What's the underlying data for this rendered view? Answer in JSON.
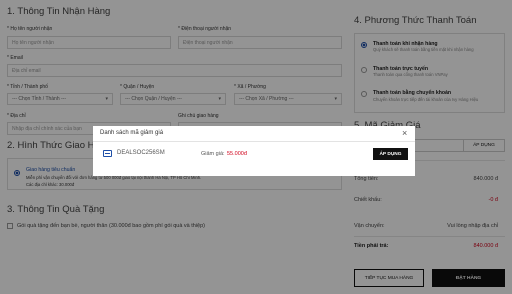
{
  "receiver": {
    "title": "1. Thông Tin Nhận Hàng",
    "name_label": "* Họ tên người nhận",
    "name_placeholder": "Họ tên người nhận",
    "phone_label": "* Điện thoại người nhận",
    "phone_placeholder": "Điện thoại người nhận",
    "email_label": "* Email",
    "email_placeholder": "Địa chỉ email",
    "province_label": "* Tỉnh / Thành phố",
    "province_value": "--- Chọn Tỉnh / Thành ---",
    "district_label": "* Quận / Huyện",
    "district_value": "--- Chọn Quận / Huyện ---",
    "ward_label": "* Xã / Phường",
    "ward_value": "--- Chọn Xã / Phường ---",
    "address_label": "* Địa chỉ",
    "address_placeholder": "Nhập địa chỉ chính xác của bạn",
    "note_label": "Ghi chú giao hàng"
  },
  "shipping": {
    "title": "2. Hình Thức Giao Hàng",
    "option_title": "Giao hàng tiêu chuẩn",
    "option_desc": "Miễn phí vận chuyển đối với đơn hàng từ 500 000đ giao tại nội thành Hà Nội, TP Hồ Chí Minh.",
    "option_fee": "Các địa chỉ khác: 30.000đ"
  },
  "gift": {
    "title": "3. Thông Tin Quà Tặng",
    "checkbox_label": "Gói quà tặng đến bạn bè, người thân (30.000đ bao gồm phí gói quà và thiệp)"
  },
  "payment": {
    "title": "4. Phương Thức Thanh Toán",
    "methods": [
      {
        "title": "Thanh toán khi nhận hàng",
        "desc": "Quý khách sẽ thanh toán bằng tiền mặt khi nhận hàng"
      },
      {
        "title": "Thanh toán trực tuyến",
        "desc": "Thanh toán qua cổng thanh toán VNPay"
      },
      {
        "title": "Thanh toán bằng chuyển khoản",
        "desc": "Chuyển khoản trực tiếp đến tài khoản của Ivy Hàng Hiệu"
      }
    ]
  },
  "discount": {
    "title": "5. Mã Giảm Giá",
    "apply_label": "ÁP DỤNG"
  },
  "summary": {
    "total_label": "Tổng tiền:",
    "total_value": "840.000 đ",
    "discount_label": "Chiết khấu:",
    "discount_value": "-0 đ",
    "shipping_label": "Vận chuyển:",
    "shipping_value": "Vui lòng nhập địa chỉ",
    "pay_label": "Tiền phải trả:",
    "pay_value": "840.000 đ",
    "continue_label": "TIẾP TỤC MUA HÀNG",
    "order_label": "ĐẶT HÀNG"
  },
  "modal": {
    "title": "Danh sách mã giảm giá",
    "close": "×",
    "code": "DEALSOC256SM",
    "discount_text": "Giảm giá:",
    "discount_amount": "55.000đ",
    "apply_label": "ÁP DỤNG"
  },
  "colors": {
    "accent_red": "#d0021b",
    "brand_blue": "#1e4fa8",
    "button_dark": "#111111"
  }
}
